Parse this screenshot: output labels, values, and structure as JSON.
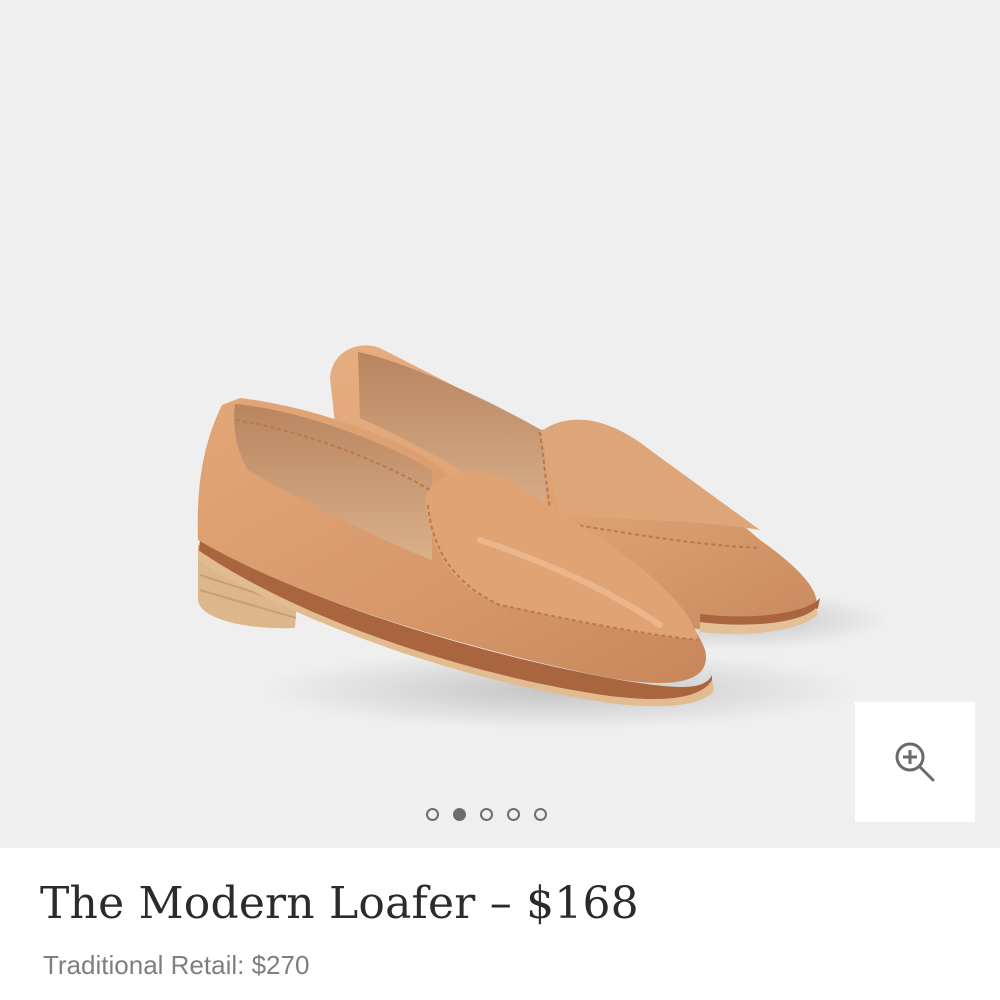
{
  "product": {
    "title": "The Modern Loafer – $168",
    "retail_price": "Traditional Retail: $270"
  },
  "gallery": {
    "image_alt": "Tan leather loafers",
    "zoom_icon": "zoom-in-icon",
    "slide_count": 5,
    "active_slide": 2
  },
  "colors": {
    "gallery_bg": "#efefef",
    "leather": "#d8996a",
    "sole": "#e3bb8c",
    "title": "#2b2b2b",
    "retail": "#7f7f7f",
    "indicator": "#6d6d6d"
  }
}
